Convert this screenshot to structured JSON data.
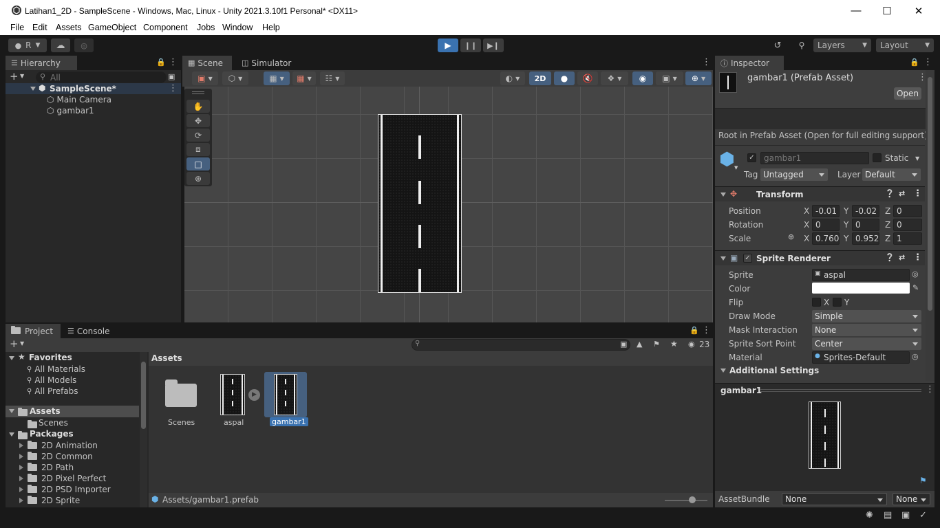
{
  "window": {
    "title": "Latihan1_2D - SampleScene - Windows, Mac, Linux - Unity 2021.3.10f1 Personal* <DX11>"
  },
  "menu": [
    "File",
    "Edit",
    "Assets",
    "GameObject",
    "Component",
    "Jobs",
    "Window",
    "Help"
  ],
  "toolbar": {
    "account": "R",
    "layers": "Layers",
    "layout": "Layout"
  },
  "hierarchy": {
    "tab": "Hierarchy",
    "search_placeholder": "All",
    "scene": "SampleScene*",
    "items": [
      "Main Camera",
      "gambar1"
    ]
  },
  "scene_view": {
    "tabs": [
      "Scene",
      "Simulator"
    ],
    "mode_2d": "2D"
  },
  "inspector": {
    "tab": "Inspector",
    "asset_title": "gambar1 (Prefab Asset)",
    "open_button": "Open",
    "root_note": "Root in Prefab Asset (Open for full editing support)",
    "object_name": "gambar1",
    "static_label": "Static",
    "tag_label": "Tag",
    "tag_value": "Untagged",
    "layer_label": "Layer",
    "layer_value": "Default",
    "transform": {
      "title": "Transform",
      "position": {
        "label": "Position",
        "x": "-0.01",
        "y": "-0.02",
        "z": "0"
      },
      "rotation": {
        "label": "Rotation",
        "x": "0",
        "y": "0",
        "z": "0"
      },
      "scale": {
        "label": "Scale",
        "x": "0.760",
        "y": "0.952",
        "z": "1"
      }
    },
    "sprite_renderer": {
      "title": "Sprite Renderer",
      "sprite_label": "Sprite",
      "sprite_value": "aspal",
      "color_label": "Color",
      "color_value": "#ffffff",
      "flip_label": "Flip",
      "flip_x": "X",
      "flip_y": "Y",
      "draw_mode_label": "Draw Mode",
      "draw_mode_value": "Simple",
      "mask_label": "Mask Interaction",
      "mask_value": "None",
      "sort_point_label": "Sprite Sort Point",
      "sort_point_value": "Center",
      "material_label": "Material",
      "material_value": "Sprites-Default",
      "additional": "Additional Settings"
    },
    "preview_title": "gambar1",
    "assetbundle_label": "AssetBundle",
    "assetbundle_value": "None",
    "assetbundle_variant": "None"
  },
  "project": {
    "tabs": [
      "Project",
      "Console"
    ],
    "hidden_count": "23",
    "favorites": {
      "label": "Favorites",
      "items": [
        "All Materials",
        "All Models",
        "All Prefabs"
      ]
    },
    "assets_label": "Assets",
    "assets_children": [
      "Scenes"
    ],
    "packages_label": "Packages",
    "packages": [
      "2D Animation",
      "2D Common",
      "2D Path",
      "2D Pixel Perfect",
      "2D PSD Importer",
      "2D Sprite"
    ],
    "breadcrumb": "Assets",
    "grid_items": [
      "Scenes",
      "aspal",
      "gambar1"
    ],
    "footer_path": "Assets/gambar1.prefab"
  }
}
